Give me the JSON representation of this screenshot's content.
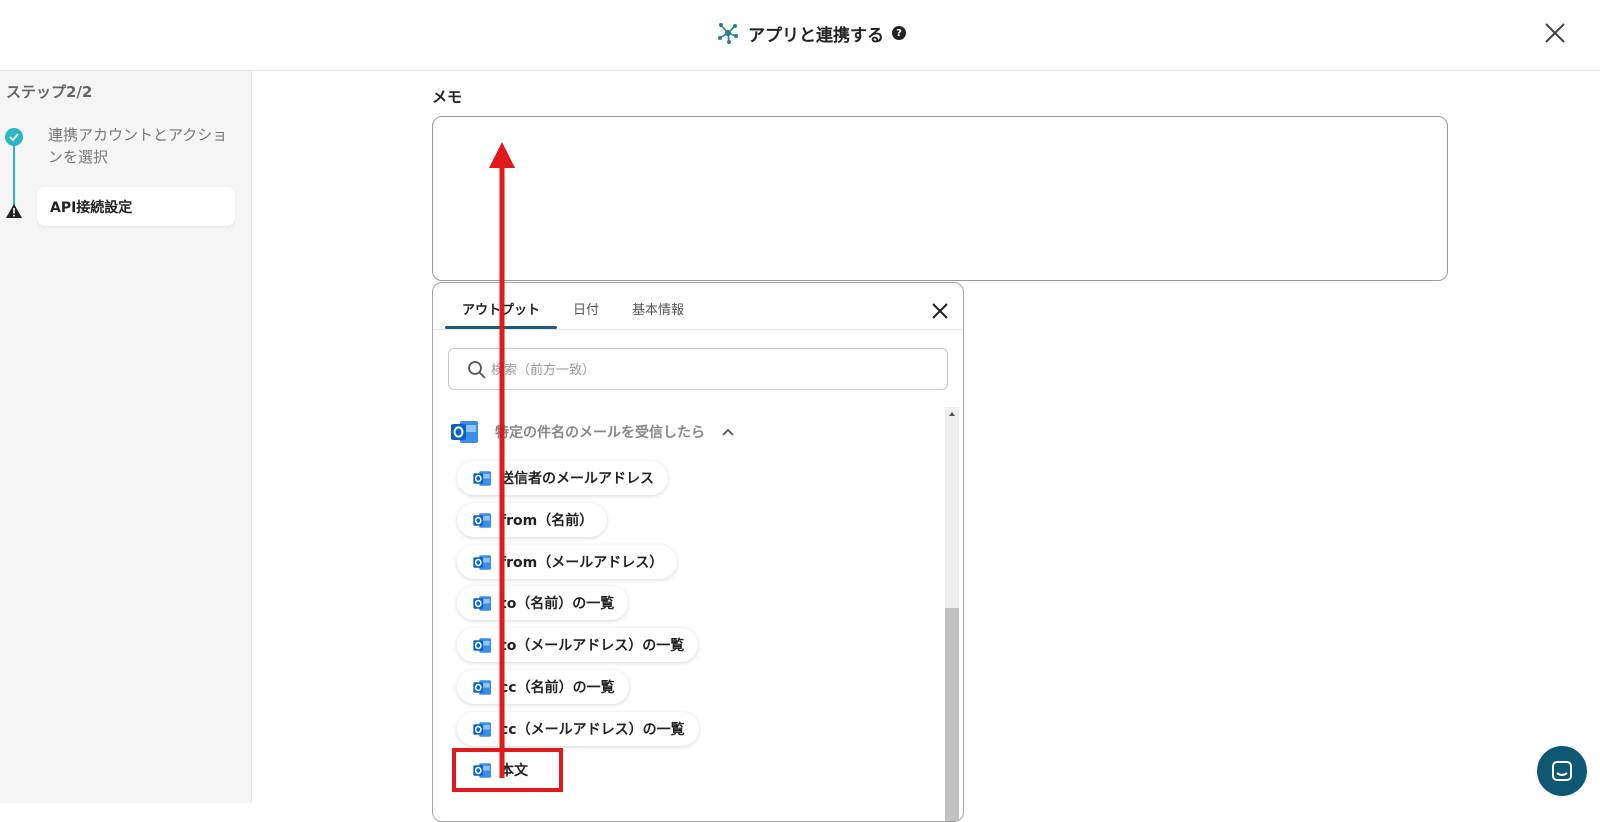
{
  "header": {
    "title": "アプリと連携する",
    "help_glyph": "?"
  },
  "sidebar": {
    "step_header": "ステップ2/2",
    "steps": [
      {
        "label": "連携アカウントとアクションを選択",
        "status": "done"
      },
      {
        "label": "API接続設定",
        "status": "warning"
      }
    ]
  },
  "memo": {
    "label": "メモ",
    "value": ""
  },
  "panel": {
    "tabs": [
      {
        "label": "アウトプット",
        "active": true
      },
      {
        "label": "日付",
        "active": false
      },
      {
        "label": "基本情報",
        "active": false
      }
    ],
    "search_placeholder": "検索（前方一致）",
    "group_label": "特定の件名のメールを受信したら",
    "items": [
      "送信者のメールアドレス",
      "from（名前）",
      "from（メールアドレス）",
      "to（名前）の一覧",
      "to（メールアドレス）の一覧",
      "cc（名前）の一覧",
      "cc（メールアドレス）の一覧",
      "本文"
    ]
  },
  "colors": {
    "accent": "#2db6c4",
    "tab_underline": "#1f5c7a",
    "annotation": "#e01a1a",
    "chat": "#0f5874",
    "outlook": "#0a64c8"
  },
  "icons": [
    "network-icon",
    "help-icon",
    "close-icon",
    "check-icon",
    "warning-icon",
    "search-icon",
    "outlook-icon",
    "chevron-up-icon",
    "chat-icon"
  ]
}
